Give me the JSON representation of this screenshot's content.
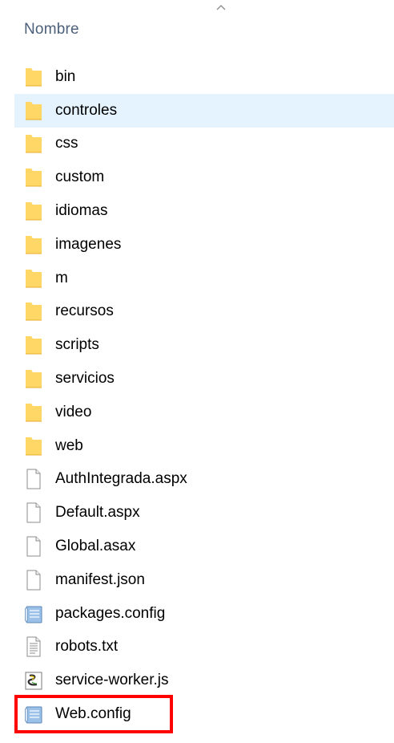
{
  "header": {
    "column_name": "Nombre",
    "sort_indicator_icon": "chevron-up-icon"
  },
  "items": [
    {
      "label": "bin",
      "type": "folder",
      "icon": "folder-icon"
    },
    {
      "label": "controles",
      "type": "folder",
      "icon": "folder-icon",
      "hovered": true
    },
    {
      "label": "css",
      "type": "folder",
      "icon": "folder-icon"
    },
    {
      "label": "custom",
      "type": "folder",
      "icon": "folder-icon"
    },
    {
      "label": "idiomas",
      "type": "folder",
      "icon": "folder-icon"
    },
    {
      "label": "imagenes",
      "type": "folder",
      "icon": "folder-icon"
    },
    {
      "label": "m",
      "type": "folder",
      "icon": "folder-icon"
    },
    {
      "label": "recursos",
      "type": "folder",
      "icon": "folder-icon"
    },
    {
      "label": "scripts",
      "type": "folder",
      "icon": "folder-icon"
    },
    {
      "label": "servicios",
      "type": "folder",
      "icon": "folder-icon"
    },
    {
      "label": "video",
      "type": "folder",
      "icon": "folder-icon"
    },
    {
      "label": "web",
      "type": "folder",
      "icon": "folder-icon"
    },
    {
      "label": "AuthIntegrada.aspx",
      "type": "file",
      "icon": "blank-file-icon"
    },
    {
      "label": "Default.aspx",
      "type": "file",
      "icon": "blank-file-icon"
    },
    {
      "label": "Global.asax",
      "type": "file",
      "icon": "blank-file-icon"
    },
    {
      "label": "manifest.json",
      "type": "file",
      "icon": "blank-file-icon"
    },
    {
      "label": "packages.config",
      "type": "file",
      "icon": "config-file-icon"
    },
    {
      "label": "robots.txt",
      "type": "file",
      "icon": "text-file-icon"
    },
    {
      "label": "service-worker.js",
      "type": "file",
      "icon": "script-file-icon"
    },
    {
      "label": "Web.config",
      "type": "file",
      "icon": "config-file-icon",
      "highlighted": true
    }
  ],
  "colors": {
    "hover_background": "#e5f3ff",
    "highlight_border": "#ff0000",
    "header_text": "#4c607a",
    "folder_yellow": "#ffd767"
  }
}
